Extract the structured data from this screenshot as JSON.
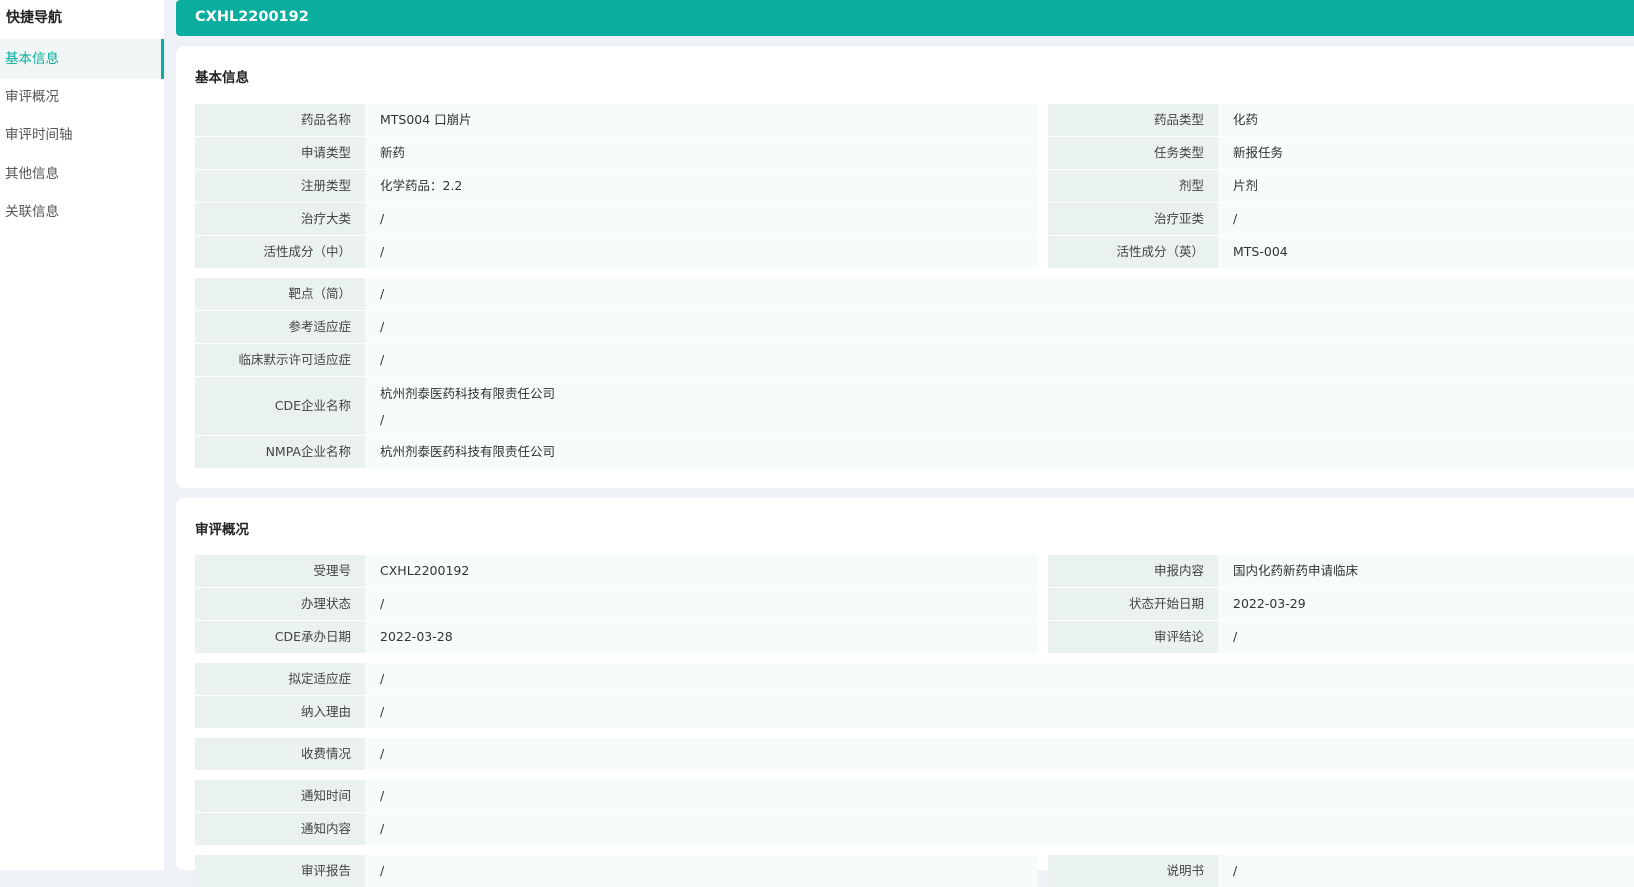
{
  "sidebar": {
    "title": "快捷导航",
    "items": [
      {
        "label": "基本信息",
        "active": true
      },
      {
        "label": "审评概况",
        "active": false
      },
      {
        "label": "审评时间轴",
        "active": false
      },
      {
        "label": "其他信息",
        "active": false
      },
      {
        "label": "关联信息",
        "active": false
      }
    ]
  },
  "header": {
    "title": "CXHL2200192"
  },
  "colors": {
    "accent": "#0aae9f",
    "label_bg": "#e9f1f1",
    "value_bg": "#f6fbfb",
    "page_bg": "#eef1f6"
  },
  "basic": {
    "title": "基本信息",
    "pairs": [
      {
        "l1": "药品名称",
        "v1": "MTS004 口崩片",
        "l2": "药品类型",
        "v2": "化药"
      },
      {
        "l1": "申请类型",
        "v1": "新药",
        "l2": "任务类型",
        "v2": "新报任务"
      },
      {
        "l1": "注册类型",
        "v1": "化学药品：2.2",
        "l2": "剂型",
        "v2": "片剂"
      },
      {
        "l1": "治疗大类",
        "v1": "/",
        "l2": "治疗亚类",
        "v2": "/"
      },
      {
        "l1": "活性成分（中）",
        "v1": "/",
        "l2": "活性成分（英）",
        "v2": "MTS-004"
      }
    ],
    "singles": [
      {
        "label": "靶点（简）",
        "value": "/"
      },
      {
        "label": "参考适应症",
        "value": "/"
      },
      {
        "label": "临床默示许可适应症",
        "value": "/"
      }
    ],
    "cde_company": {
      "label": "CDE企业名称",
      "value": "杭州剂泰医药科技有限责任公司",
      "value2": "/"
    },
    "nmpa_company": {
      "label": "NMPA企业名称",
      "value": "杭州剂泰医药科技有限责任公司"
    }
  },
  "review": {
    "title": "审评概况",
    "pairs": [
      {
        "l1": "受理号",
        "v1": "CXHL2200192",
        "l2": "申报内容",
        "v2": "国内化药新药申请临床"
      },
      {
        "l1": "办理状态",
        "v1": "/",
        "l2": "状态开始日期",
        "v2": "2022-03-29"
      },
      {
        "l1": "CDE承办日期",
        "v1": "2022-03-28",
        "l2": "审评结论",
        "v2": "/"
      }
    ],
    "group1": [
      {
        "label": "拟定适应症",
        "value": "/"
      },
      {
        "label": "纳入理由",
        "value": "/"
      }
    ],
    "group2": [
      {
        "label": "收费情况",
        "value": "/"
      }
    ],
    "group3": [
      {
        "label": "通知时间",
        "value": "/"
      },
      {
        "label": "通知内容",
        "value": "/"
      }
    ],
    "partial": {
      "l1": "审评报告",
      "v1": "/",
      "l2": "说明书",
      "v2": "/"
    }
  }
}
